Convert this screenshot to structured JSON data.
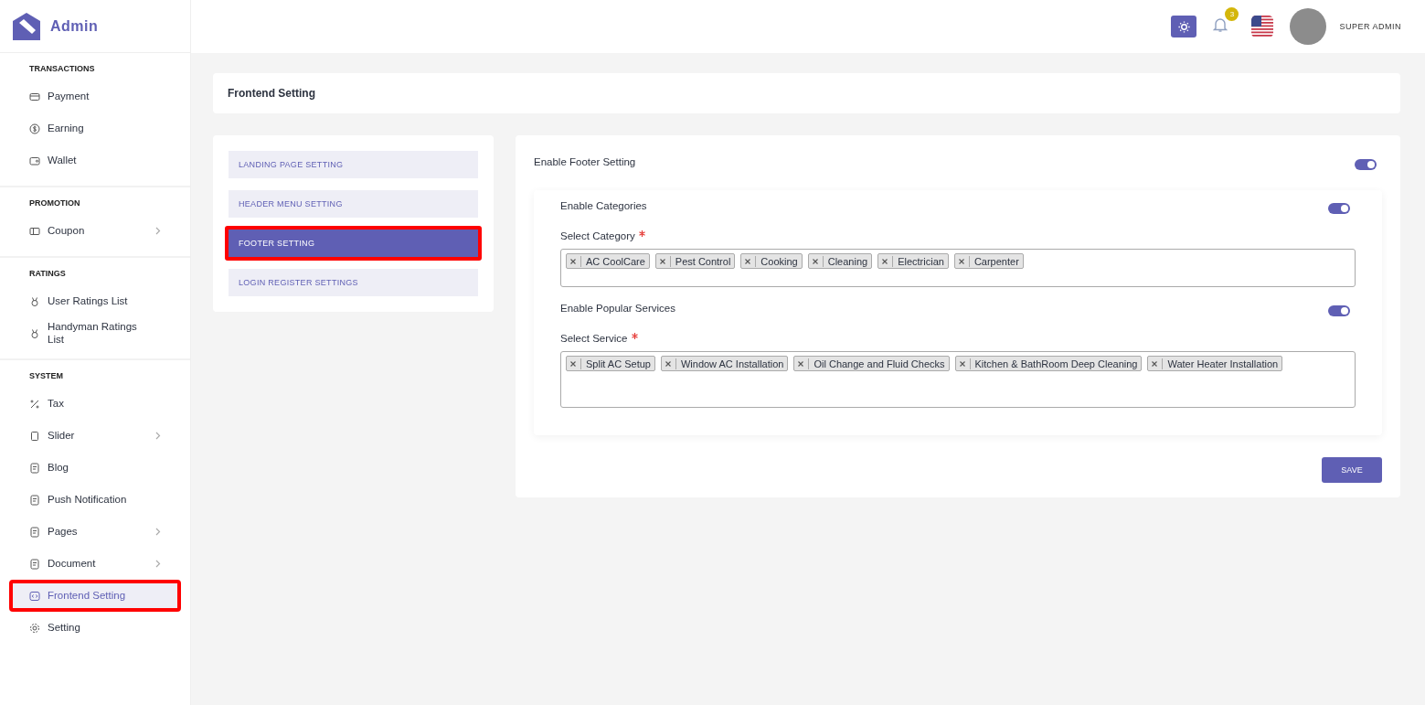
{
  "brand": {
    "name": "Admin"
  },
  "header": {
    "notification_count": "3",
    "user_name": "SUPER ADMIN"
  },
  "sidebar": {
    "sections": [
      {
        "title": "TRANSACTIONS",
        "items": [
          {
            "label": "Payment",
            "has_submenu": false,
            "selected": false,
            "highlighted": false
          },
          {
            "label": "Earning",
            "has_submenu": false,
            "selected": false,
            "highlighted": false
          },
          {
            "label": "Wallet",
            "has_submenu": false,
            "selected": false,
            "highlighted": false
          }
        ]
      },
      {
        "title": "PROMOTION",
        "items": [
          {
            "label": "Coupon",
            "has_submenu": true,
            "selected": false,
            "highlighted": false
          }
        ]
      },
      {
        "title": "RATINGS",
        "items": [
          {
            "label": "User Ratings List",
            "has_submenu": false,
            "selected": false,
            "highlighted": false
          },
          {
            "label": "Handyman Ratings List",
            "has_submenu": false,
            "selected": false,
            "highlighted": false
          }
        ]
      },
      {
        "title": "SYSTEM",
        "items": [
          {
            "label": "Tax",
            "has_submenu": false,
            "selected": false,
            "highlighted": false
          },
          {
            "label": "Slider",
            "has_submenu": true,
            "selected": false,
            "highlighted": false
          },
          {
            "label": "Blog",
            "has_submenu": false,
            "selected": false,
            "highlighted": false
          },
          {
            "label": "Push Notification",
            "has_submenu": false,
            "selected": false,
            "highlighted": false
          },
          {
            "label": "Pages",
            "has_submenu": true,
            "selected": false,
            "highlighted": false
          },
          {
            "label": "Document",
            "has_submenu": true,
            "selected": false,
            "highlighted": false
          },
          {
            "label": "Frontend Setting",
            "has_submenu": false,
            "selected": true,
            "highlighted": true
          },
          {
            "label": "Setting",
            "has_submenu": false,
            "selected": false,
            "highlighted": false
          }
        ]
      }
    ]
  },
  "page_title": "Frontend Setting",
  "settings_tabs": [
    {
      "label": "LANDING PAGE SETTING",
      "selected": false,
      "highlighted": false
    },
    {
      "label": "HEADER MENU SETTING",
      "selected": false,
      "highlighted": false
    },
    {
      "label": "FOOTER SETTING",
      "selected": true,
      "highlighted": true
    },
    {
      "label": "LOGIN REGISTER SETTINGS",
      "selected": false,
      "highlighted": false
    }
  ],
  "footer_setting": {
    "label": "Enable Footer Setting",
    "on": true,
    "groups": [
      {
        "toggle_label": "Enable Categories",
        "on": true,
        "select_label": "Select Category",
        "required": true,
        "chips": [
          "AC CoolCare",
          "Pest Control",
          "Cooking",
          "Cleaning",
          "Electrician",
          "Carpenter"
        ]
      },
      {
        "toggle_label": "Enable Popular Services",
        "on": true,
        "select_label": "Select Service",
        "required": true,
        "chips": [
          "Split AC Setup",
          "Window AC Installation",
          "Oil Change and Fluid Checks",
          "Kitchen & BathRoom Deep Cleaning",
          "Water Heater Installation"
        ]
      }
    ]
  },
  "save_button": "SAVE"
}
